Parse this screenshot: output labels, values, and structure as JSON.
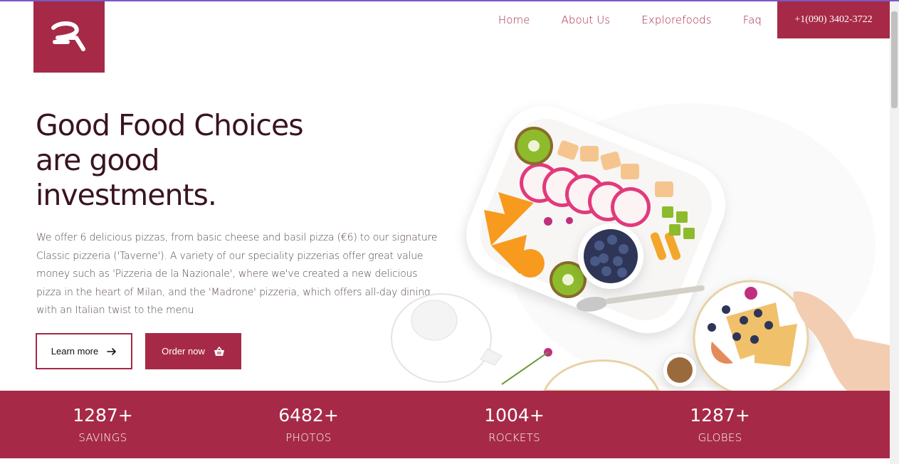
{
  "brand": {
    "logo_icon": "stylized-2-logo-icon",
    "accent_color": "#a62a47"
  },
  "nav": {
    "items": [
      {
        "label": "Home"
      },
      {
        "label": "About Us"
      },
      {
        "label": "Explorefoods"
      },
      {
        "label": "Faq"
      }
    ],
    "phone": "+1(090) 3402-3722"
  },
  "hero": {
    "title_lines": [
      "Good Food Choices",
      "are good",
      "investments."
    ],
    "description": "We offer 6 delicious pizzas, from basic cheese and basil pizza (€6) to our signature Classic pizzeria ('Taverne'). A variety of our speciality pizzerias offer great value money such as 'Pizzeria de la Nazionale', where we've created a new delicious pizza in the heart of Milan, and the 'Madrone' pizzeria, which offers all-day dining, with an Italian twist to the menu",
    "learn_more_label": "Learn more",
    "learn_more_icon": "arrow-right-icon",
    "order_label": "Order now",
    "order_icon": "shopping-basket-icon"
  },
  "stats": [
    {
      "value": "1287+",
      "label": "SAVINGS"
    },
    {
      "value": "6482+",
      "label": "PHOTOS"
    },
    {
      "value": "1004+",
      "label": "ROCKETS"
    },
    {
      "value": "1287+",
      "label": "GLOBES"
    }
  ]
}
